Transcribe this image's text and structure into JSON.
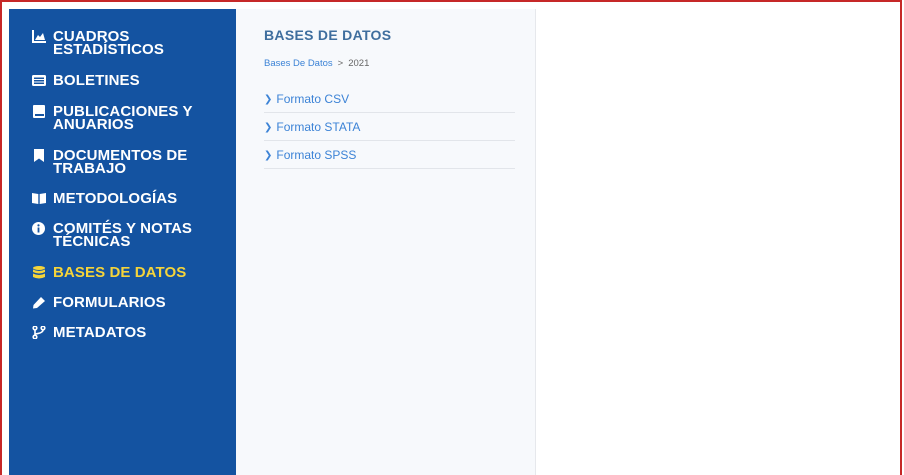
{
  "sidebar": {
    "items": [
      {
        "icon": "chart-icon",
        "label": "CUADROS ESTADÍSTICOS"
      },
      {
        "icon": "list-icon",
        "label": "BOLETINES"
      },
      {
        "icon": "book-icon",
        "label": "PUBLICACIONES Y ANUARIOS"
      },
      {
        "icon": "bookmark-icon",
        "label": "DOCUMENTOS DE TRABAJO"
      },
      {
        "icon": "open-book-icon",
        "label": "METODOLOGÍAS"
      },
      {
        "icon": "info-icon",
        "label": "COMITÉS Y NOTAS TÉCNICAS"
      },
      {
        "icon": "database-icon",
        "label": "BASES DE DATOS"
      },
      {
        "icon": "pencil-icon",
        "label": "FORMULARIOS"
      },
      {
        "icon": "fork-icon",
        "label": "METADATOS"
      }
    ],
    "active_label": "BASES DE DATOS"
  },
  "panel": {
    "title": "BASES DE DATOS",
    "breadcrumb": {
      "parent": "Bases De Datos",
      "separator": ">",
      "current": "2021"
    },
    "links": [
      {
        "label": "Formato CSV"
      },
      {
        "label": "Formato STATA"
      },
      {
        "label": "Formato SPSS"
      }
    ]
  },
  "colors": {
    "sidebar_bg": "#1453a1",
    "active": "#f5d43a",
    "link": "#3c83d6",
    "title": "#3f6e9e",
    "frame": "#c62828"
  }
}
